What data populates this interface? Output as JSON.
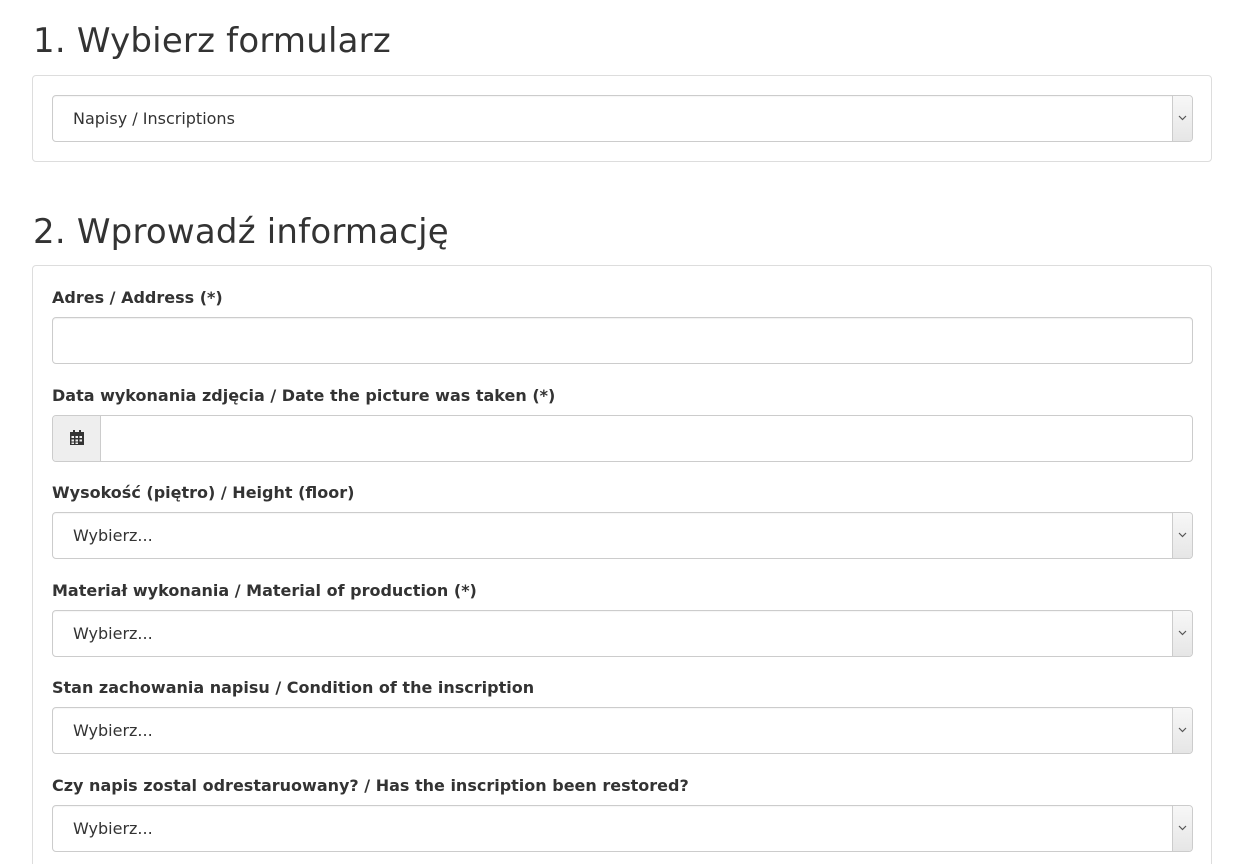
{
  "step1": {
    "title": "1. Wybierz formularz",
    "form_select": {
      "value": "Napisy / Inscriptions"
    }
  },
  "step2": {
    "title": "2. Wprowadź informację",
    "fields": {
      "address": {
        "label": "Adres / Address (*)",
        "value": ""
      },
      "date": {
        "label": "Data wykonania zdjęcia / Date the picture was taken (*)",
        "value": "",
        "icon": "calendar-icon"
      },
      "height": {
        "label": "Wysokość (piętro) / Height (floor)",
        "value": "Wybierz..."
      },
      "material": {
        "label": "Materiał wykonania / Material of production (*)",
        "value": "Wybierz..."
      },
      "condition": {
        "label": "Stan zachowania napisu / Condition of the inscription",
        "value": "Wybierz..."
      },
      "restored": {
        "label": "Czy napis zostal odrestaruowany? / Has the inscription been restored?",
        "value": "Wybierz..."
      }
    }
  },
  "colors": {
    "text": "#333333",
    "border": "#cccccc",
    "panel_border": "#dddddd",
    "addon_bg": "#eeeeee"
  }
}
